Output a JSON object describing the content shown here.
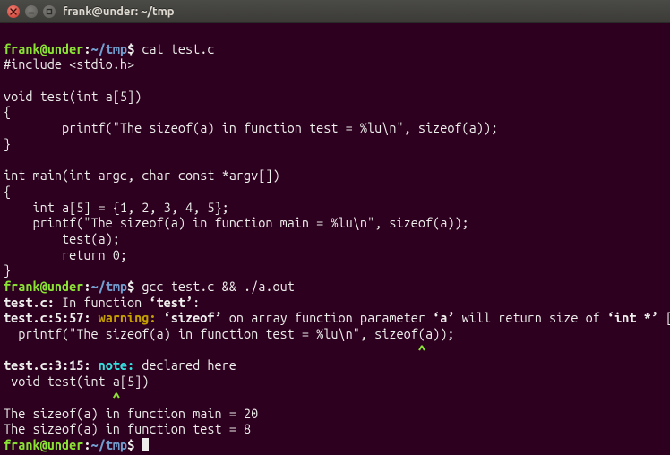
{
  "window": {
    "title": "frank@under: ~/tmp"
  },
  "prompt": {
    "user_host": "frank@under",
    "sep1": ":",
    "path": "~/tmp",
    "sep2": "$ "
  },
  "session": {
    "cmd1": "cat test.c",
    "source": {
      "l1": "#include <stdio.h>",
      "l2": "",
      "l3": "void test(int a[5])",
      "l4": "{",
      "l5": "        printf(\"The sizeof(a) in function test = %lu\\n\", sizeof(a));",
      "l6": "}",
      "l7": "",
      "l8": "int main(int argc, char const *argv[])",
      "l9": "{",
      "l10": "    int a[5] = {1, 2, 3, 4, 5};",
      "l11": "    printf(\"The sizeof(a) in function main = %lu\\n\", sizeof(a));",
      "l12": "        test(a);",
      "l13": "        return 0;",
      "l14": "}"
    },
    "cmd2": "gcc test.c && ./a.out",
    "compile": {
      "in_func_pre": "test.c:",
      "in_func_mid": " In function ",
      "in_func_name": "‘test’",
      "in_func_colon": ":",
      "warn_loc": "test.c:5:57:",
      "warn_kw": " warning: ",
      "warn_msg1": "‘sizeof’",
      "warn_msg2": " on array function parameter ",
      "warn_msg3": "‘a’",
      "warn_msg4": " will return size of ",
      "warn_msg5": "‘int *’",
      "warn_flag": " [-Wsizeof-array-argument]",
      "warn_code": "  printf(\"The sizeof(a) in function test = %lu\\n\", sizeof(a));",
      "warn_caret": "                                                         ^",
      "note_loc": "test.c:3:15:",
      "note_kw": " note: ",
      "note_msg": "declared here",
      "note_code": " void test(int a[5])",
      "note_caret": "               ^"
    },
    "output": {
      "o1": "The sizeof(a) in function main = 20",
      "o2": "The sizeof(a) in function test = 8"
    }
  }
}
